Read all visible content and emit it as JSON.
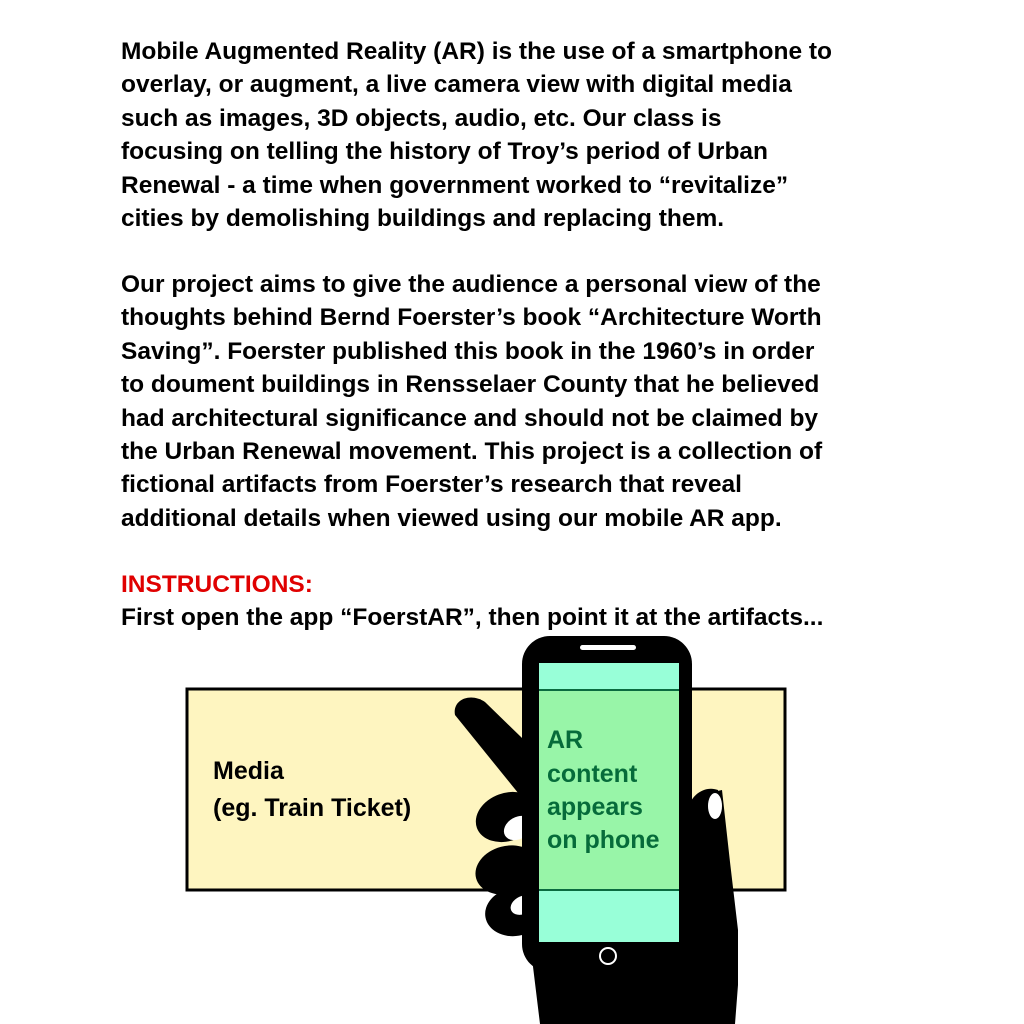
{
  "intro": {
    "lines": [
      "Mobile Augmented Reality (AR) is the use of a smartphone to",
      "overlay, or augment, a live camera view with digital media",
      "such as images, 3D objects, audio, etc.  Our class is",
      "focusing on telling the history of Troy’s period of Urban",
      "Renewal - a time when government worked to “revitalize”",
      "cities by demolishing buildings and replacing them."
    ]
  },
  "project": {
    "lines": [
      "Our project aims to give the audience a personal view of the",
      "thoughts behind Bernd Foerster’s book “Architecture Worth",
      "Saving”. Foerster published this book in the 1960’s in order",
      "to doument buildings in Rensselaer County that he believed",
      "had architectural significance and should not be claimed by",
      "the Urban Renewal movement.  This project is a collection of",
      "fictional artifacts from Foerster’s research that reveal",
      "additional details when viewed using our mobile AR app."
    ]
  },
  "instructions": {
    "heading": "INSTRUCTIONS:",
    "text": "First open the app “FoerstAR”, then point it at the artifacts..."
  },
  "diagram": {
    "media_label": [
      "Media",
      "(eg. Train Ticket)"
    ],
    "phone_label": [
      "AR",
      "content",
      "appears",
      "on phone"
    ],
    "colors": {
      "media_card_fill": "#fef5c0",
      "screen_green": "#98f5a8",
      "screen_teal": "#98ffd8",
      "phone_text": "#066b3a",
      "hand": "#000000",
      "heading_red": "#e00000"
    },
    "icons": [
      "smartphone",
      "hand"
    ]
  }
}
